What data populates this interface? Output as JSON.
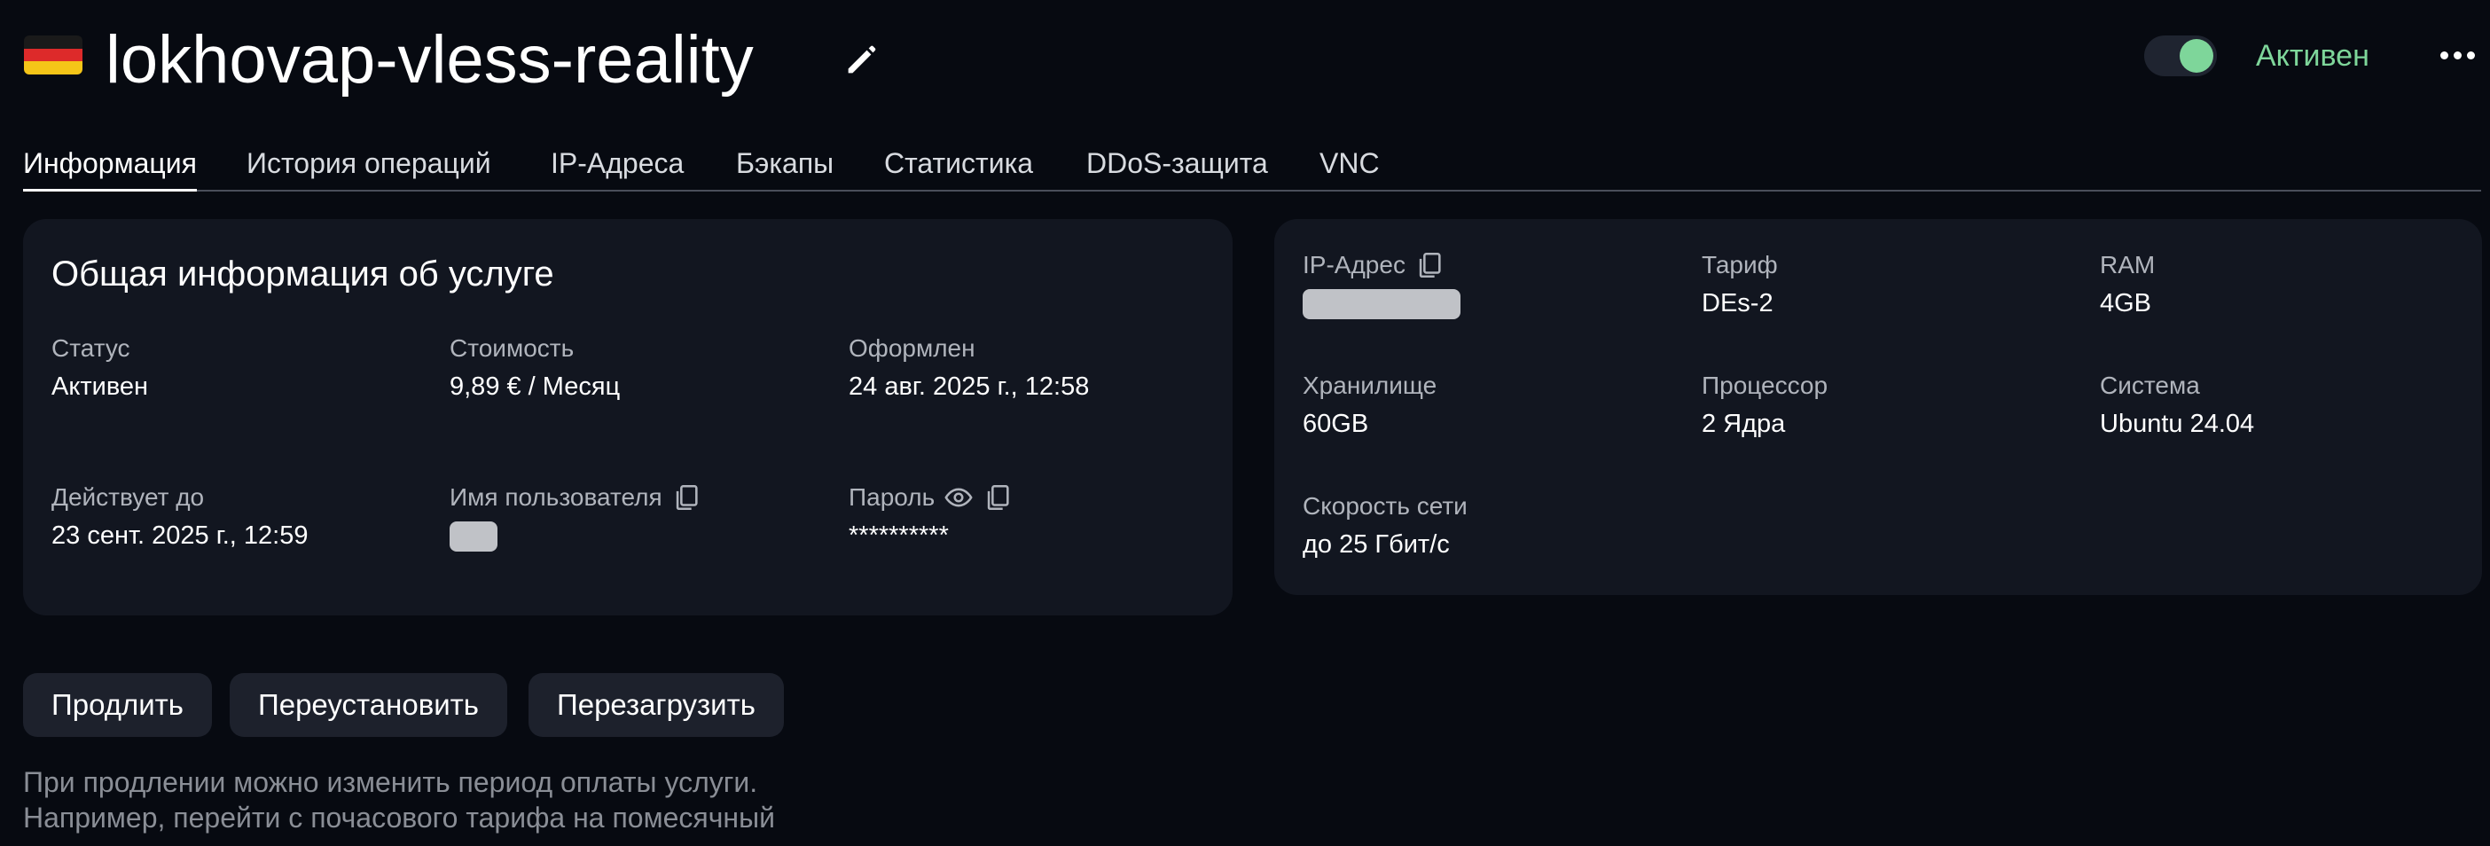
{
  "header": {
    "flag_icon": "germany-flag-icon",
    "title": "lokhovap-vless-reality",
    "edit_icon": "pencil-icon",
    "status_label": "Активен",
    "status_color": "#7ed69a",
    "more_icon": "more-horizontal-icon"
  },
  "tabs": [
    {
      "label": "Информация",
      "active": true
    },
    {
      "label": "История операций",
      "active": false
    },
    {
      "label": "IP-Адреса",
      "active": false
    },
    {
      "label": "Бэкапы",
      "active": false
    },
    {
      "label": "Статистика",
      "active": false
    },
    {
      "label": "DDoS-защита",
      "active": false
    },
    {
      "label": "VNC",
      "active": false
    }
  ],
  "general_info": {
    "title": "Общая информация об услуге",
    "status": {
      "label": "Статус",
      "value": "Активен"
    },
    "cost": {
      "label": "Стоимость",
      "value": "9,89 € / Месяц"
    },
    "created": {
      "label": "Оформлен",
      "value": "24 авг. 2025 г., 12:58"
    },
    "valid_until": {
      "label": "Действует до",
      "value": "23 сент. 2025 г., 12:59"
    },
    "username": {
      "label": "Имя пользователя"
    },
    "password": {
      "label": "Пароль",
      "value": "**********"
    }
  },
  "specs": {
    "ip": {
      "label": "IP-Адрес"
    },
    "tariff": {
      "label": "Тариф",
      "value": "DEs-2"
    },
    "ram": {
      "label": "RAM",
      "value": "4GB"
    },
    "storage": {
      "label": "Хранилище",
      "value": "60GB"
    },
    "cpu": {
      "label": "Процессор",
      "value": "2 Ядра"
    },
    "os": {
      "label": "Система",
      "value": "Ubuntu 24.04"
    },
    "network": {
      "label": "Скорость сети",
      "value": "до 25 Гбит/с"
    }
  },
  "actions": {
    "renew": "Продлить",
    "reinstall": "Переустановить",
    "reboot": "Перезагрузить"
  },
  "note": {
    "line1": "При продлении можно изменить период оплаты услуги.",
    "line2": "Например, перейти с почасового тарифа на помесячный"
  }
}
